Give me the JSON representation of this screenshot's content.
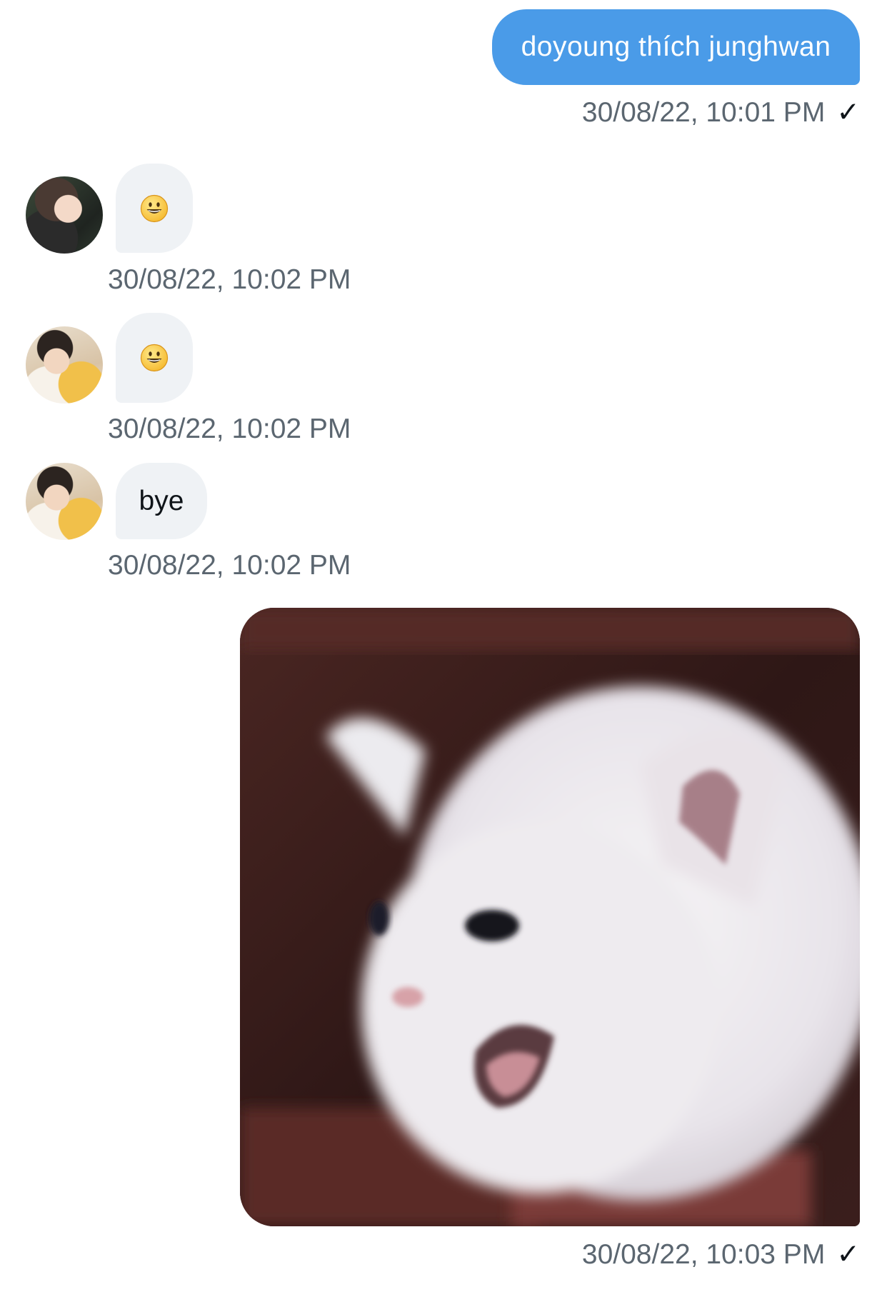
{
  "messages": [
    {
      "direction": "outgoing",
      "type": "text",
      "text": "doyoung thích junghwan",
      "timestamp": "30/08/22, 10:01 PM",
      "status": "✓"
    },
    {
      "direction": "incoming",
      "type": "emoji",
      "emoji_icon": "smiley-emoji",
      "avatar": "avatar-user-1",
      "timestamp": "30/08/22, 10:02 PM"
    },
    {
      "direction": "incoming",
      "type": "emoji",
      "emoji_icon": "smiley-emoji",
      "avatar": "avatar-user-2",
      "timestamp": "30/08/22, 10:02 PM"
    },
    {
      "direction": "incoming",
      "type": "text",
      "text": "bye",
      "avatar": "avatar-user-2",
      "timestamp": "30/08/22, 10:02 PM"
    },
    {
      "direction": "outgoing",
      "type": "image",
      "image_subject": "white-kitten-photo",
      "timestamp": "30/08/22, 10:03 PM",
      "status": "✓"
    }
  ],
  "colors": {
    "outgoing_bubble": "#4a9be8",
    "incoming_bubble": "#eff2f5",
    "timestamp_text": "#5b6670"
  }
}
